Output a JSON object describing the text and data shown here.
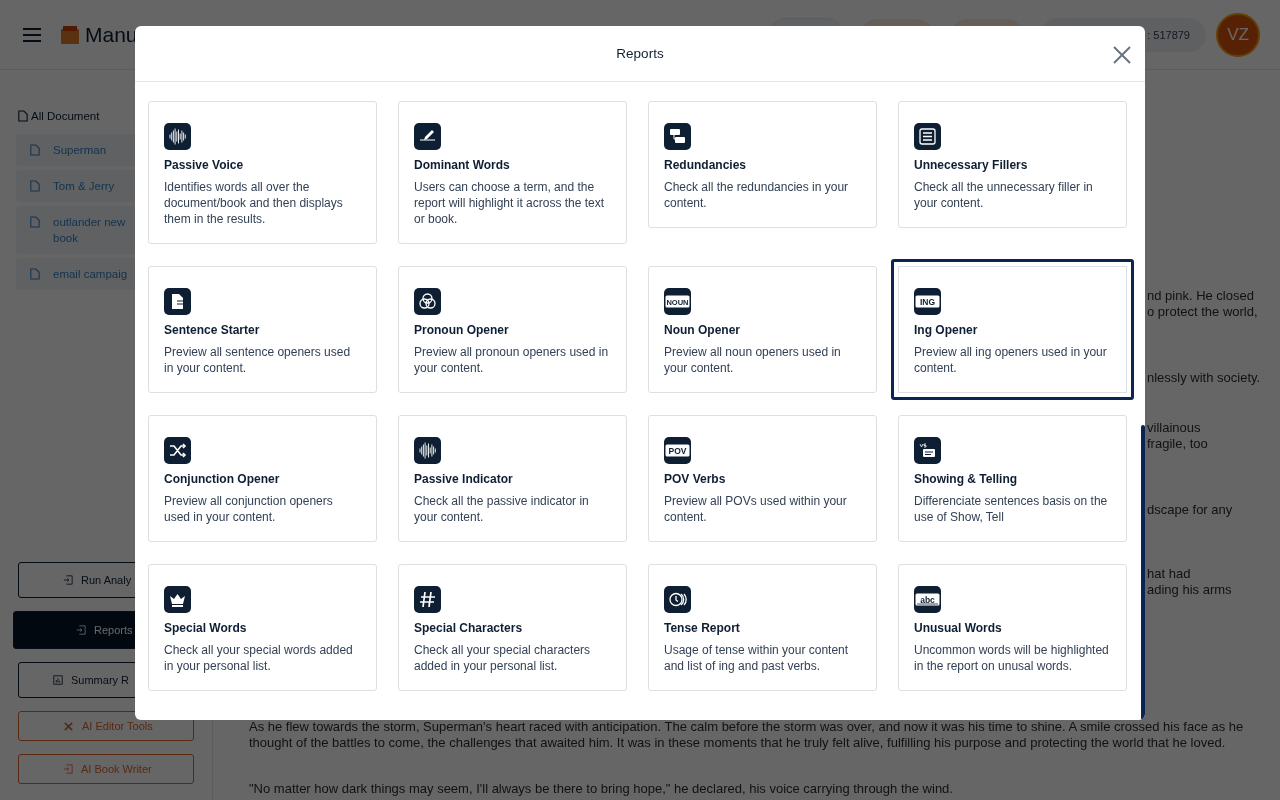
{
  "header": {
    "logo_text": "Manu",
    "credits": ": 517879",
    "avatar": "VZ"
  },
  "sidebar": {
    "heading": "All Document",
    "documents": [
      {
        "title": "Superman"
      },
      {
        "title": "Tom & Jerry"
      },
      {
        "title": "outlander new book"
      },
      {
        "title": "email campaig"
      }
    ],
    "actions": [
      {
        "label": "Run Analy",
        "kind": "outline",
        "selected": false
      },
      {
        "label": "Reports",
        "kind": "outline",
        "selected": true
      },
      {
        "label": "Summary R",
        "kind": "outline",
        "selected": false
      },
      {
        "label": "AI Editor Tools",
        "kind": "accent",
        "selected": false
      },
      {
        "label": "AI Book Writer",
        "kind": "accent",
        "selected": false
      }
    ]
  },
  "document": {
    "fragments": [
      [
        "nd pink. He closed",
        "o protect the world,"
      ],
      [
        "nlessly with society."
      ],
      [
        "villainous",
        "fragile, too"
      ],
      [
        "dscape for any"
      ],
      [
        "hat had",
        "ading his arms"
      ]
    ],
    "paragraphs": [
      "As he flew towards the storm, Superman's heart raced with anticipation. The calm before the storm was over, and now it was his time to shine. A smile crossed his face as he thought of the battles to come, the challenges that awaited him. It was in these moments that he truly felt alive, fulfilling his purpose and protecting the world that he loved.",
      "\"No matter how dark things may seem, I'll always be there to bring hope,\" he declared, his voice carrying through the wind."
    ]
  },
  "modal": {
    "title": "Reports",
    "reports": [
      {
        "title": "Passive Voice",
        "description": "Identifies words all over the document/book and then displays them in the results.",
        "selected": false
      },
      {
        "title": "Dominant Words",
        "description": "Users can choose a term, and the report will highlight it across the text or book.",
        "selected": false
      },
      {
        "title": "Redundancies",
        "description": "Check all the redundancies in your content.",
        "selected": false
      },
      {
        "title": "Unnecessary Fillers",
        "description": "Check all the unnecessary filler in your content.",
        "selected": false
      },
      {
        "title": "Sentence Starter",
        "description": "Preview all sentence openers used in your content.",
        "selected": false
      },
      {
        "title": "Pronoun Opener",
        "description": "Preview all pronoun openers used in your content.",
        "selected": false
      },
      {
        "title": "Noun Opener",
        "description": "Preview all noun openers used in your content.",
        "selected": false,
        "icon_label": "NOUN"
      },
      {
        "title": "Ing Opener",
        "description": "Preview all ing openers used in your content.",
        "selected": true,
        "icon_label": "ING"
      },
      {
        "title": "Conjunction Opener",
        "description": "Preview all conjunction openers used in your content.",
        "selected": false
      },
      {
        "title": "Passive Indicator",
        "description": "Check all the passive indicator in your content.",
        "selected": false
      },
      {
        "title": "POV Verbs",
        "description": "Preview all POVs used within your content.",
        "selected": false,
        "icon_label": "POV"
      },
      {
        "title": "Showing & Telling",
        "description": "Differenciate sentences basis on the use of Show, Tell",
        "selected": false
      },
      {
        "title": "Special Words",
        "description": "Check all your special words added in your personal list.",
        "selected": false
      },
      {
        "title": "Special Characters",
        "description": "Check all your special characters added in your personal list.",
        "selected": false
      },
      {
        "title": "Tense Report",
        "description": "Usage of tense within your content and list of ing and past verbs.",
        "selected": false
      },
      {
        "title": "Unusual Words",
        "description": "Uncommon words will be highlighted in the report on unusal words.",
        "selected": false,
        "icon_label": "abc"
      }
    ]
  }
}
